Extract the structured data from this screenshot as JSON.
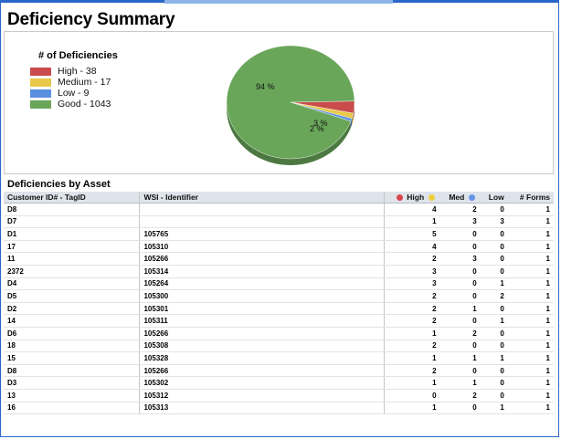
{
  "report": {
    "title": "Deficiency Summary",
    "legend_title": "# of Deficiencies",
    "legend": [
      {
        "label": "High - 38",
        "color": "#c94b4b"
      },
      {
        "label": "Medium - 17",
        "color": "#e8c94a"
      },
      {
        "label": "Low - 9",
        "color": "#5b8fe0"
      },
      {
        "label": "Good - 1043",
        "color": "#6aa65a"
      }
    ],
    "pie_labels": {
      "good": "94 %",
      "small": "3 %",
      "small2": "2 %"
    },
    "section_title": "Deficiencies by Asset"
  },
  "chart_data": {
    "type": "pie",
    "categories": [
      "High",
      "Medium",
      "Low",
      "Good"
    ],
    "values": [
      38,
      17,
      9,
      1043
    ],
    "colors": [
      "#c94b4b",
      "#e8c94a",
      "#5b8fe0",
      "#6aa65a"
    ]
  },
  "table": {
    "headers": {
      "customer_id": "Customer ID# - TagID",
      "wsi": "WSI - Identifier",
      "high": "High",
      "med": "Med",
      "low": "Low",
      "forms": "# Forms"
    },
    "dot_colors": {
      "high": "#d9454a",
      "med": "#f0cf3c",
      "low": "#6596e6"
    },
    "rows": [
      {
        "id": "D8",
        "wsi": "",
        "high": "4",
        "med": "2",
        "low": "0",
        "forms": "1"
      },
      {
        "id": "D7",
        "wsi": "",
        "high": "1",
        "med": "3",
        "low": "3",
        "forms": "1"
      },
      {
        "id": "D1",
        "wsi": "105765",
        "high": "5",
        "med": "0",
        "low": "0",
        "forms": "1"
      },
      {
        "id": "17",
        "wsi": "105310",
        "high": "4",
        "med": "0",
        "low": "0",
        "forms": "1"
      },
      {
        "id": "11",
        "wsi": "105266",
        "high": "2",
        "med": "3",
        "low": "0",
        "forms": "1"
      },
      {
        "id": "2372",
        "wsi": "105314",
        "high": "3",
        "med": "0",
        "low": "0",
        "forms": "1"
      },
      {
        "id": "D4",
        "wsi": "105264",
        "high": "3",
        "med": "0",
        "low": "1",
        "forms": "1"
      },
      {
        "id": "D5",
        "wsi": "105300",
        "high": "2",
        "med": "0",
        "low": "2",
        "forms": "1"
      },
      {
        "id": "D2",
        "wsi": "105301",
        "high": "2",
        "med": "1",
        "low": "0",
        "forms": "1"
      },
      {
        "id": "14",
        "wsi": "105311",
        "high": "2",
        "med": "0",
        "low": "1",
        "forms": "1"
      },
      {
        "id": "D6",
        "wsi": "105266",
        "high": "1",
        "med": "2",
        "low": "0",
        "forms": "1"
      },
      {
        "id": "18",
        "wsi": "105308",
        "high": "2",
        "med": "0",
        "low": "0",
        "forms": "1"
      },
      {
        "id": "15",
        "wsi": "105328",
        "high": "1",
        "med": "1",
        "low": "1",
        "forms": "1"
      },
      {
        "id": "D8",
        "wsi": "105266",
        "high": "2",
        "med": "0",
        "low": "0",
        "forms": "1"
      },
      {
        "id": "D3",
        "wsi": "105302",
        "high": "1",
        "med": "1",
        "low": "0",
        "forms": "1"
      },
      {
        "id": "13",
        "wsi": "105312",
        "high": "0",
        "med": "2",
        "low": "0",
        "forms": "1"
      },
      {
        "id": "16",
        "wsi": "105313",
        "high": "1",
        "med": "0",
        "low": "1",
        "forms": "1"
      }
    ]
  }
}
